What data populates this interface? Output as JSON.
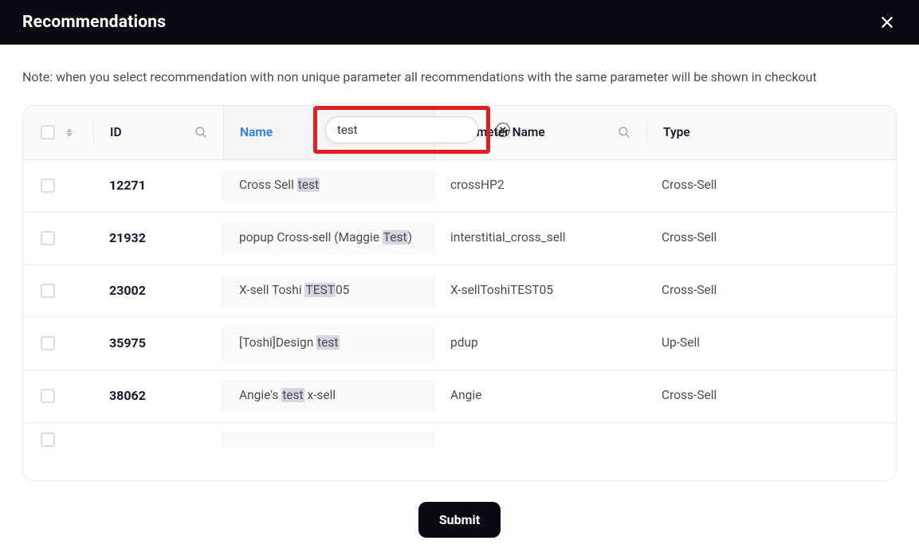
{
  "header": {
    "title": "Recommendations"
  },
  "note": "Note: when you select recommendation with non unique parameter all recommendations with the same parameter will be shown in checkout",
  "filter": {
    "name_value": "test"
  },
  "columns": {
    "id": "ID",
    "name": "Name",
    "parameter": "Parameter Name",
    "type": "Type"
  },
  "rows": [
    {
      "id": "12271",
      "name_pre": "Cross Sell ",
      "name_hl": "test",
      "name_post": "",
      "param": "crossHP2",
      "type": "Cross-Sell"
    },
    {
      "id": "21932",
      "name_pre": "popup Cross-sell (Maggie ",
      "name_hl": "Test",
      "name_post": ")",
      "param": "interstitial_cross_sell",
      "type": "Cross-Sell"
    },
    {
      "id": "23002",
      "name_pre": "X-sell Toshi ",
      "name_hl": "TEST",
      "name_post": "05",
      "param": "X-sellToshiTEST05",
      "type": "Cross-Sell"
    },
    {
      "id": "35975",
      "name_pre": "[Toshi]Design ",
      "name_hl": "test",
      "name_post": "",
      "param": "pdup",
      "type": "Up-Sell"
    },
    {
      "id": "38062",
      "name_pre": "Angie's ",
      "name_hl": "test",
      "name_post": " x-sell",
      "param": "Angie",
      "type": "Cross-Sell"
    }
  ],
  "footer": {
    "submit_label": "Submit"
  }
}
